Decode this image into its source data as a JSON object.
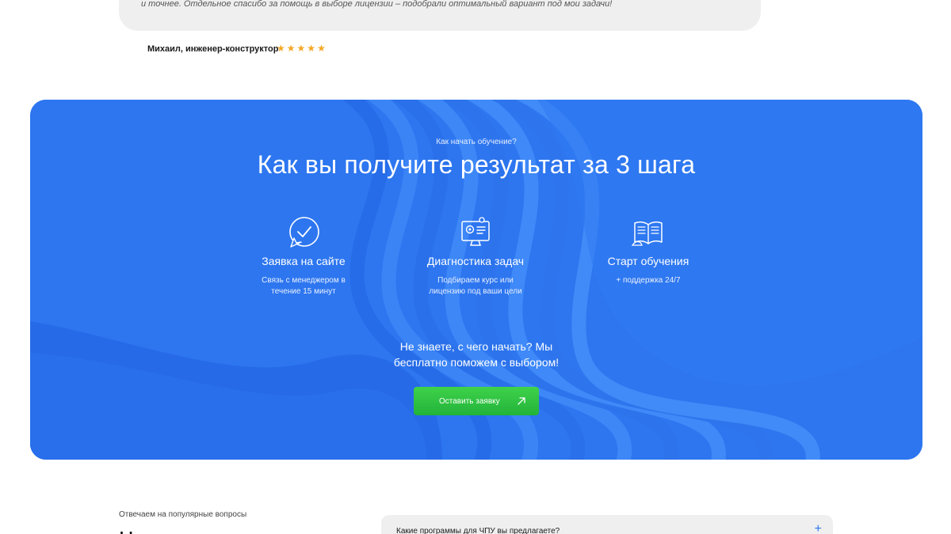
{
  "review": {
    "text": "и точнее. Отдельное спасибо за помощь в выборе лицензии – подобрали оптимальный вариант под мои задачи!",
    "author": "Михаил, инженер-конструктор",
    "rating": 5,
    "star_glyph": "★"
  },
  "steps_section": {
    "kicker": "Как начать обучение?",
    "title": "Как вы получите результат за 3 шага",
    "steps": [
      {
        "icon": "check-cursor-icon",
        "title": "Заявка на сайте",
        "desc_line1": "Связь с менеджером в",
        "desc_line2": "течение 15 минут"
      },
      {
        "icon": "monitor-gear-icon",
        "title": "Диагностика задач",
        "desc_line1": "Подбираем курс или",
        "desc_line2": "лицензию под ваши цели"
      },
      {
        "icon": "open-book-icon",
        "title": "Старт обучения",
        "desc_line1": "+ поддержка 24/7",
        "desc_line2": ""
      }
    ],
    "help_line1": "Не знаете, с чего начать? Мы",
    "help_line2": "бесплатно поможем с выбором!",
    "cta_label": "Оставить заявку",
    "colors": {
      "background": "#2d76f0",
      "cta": "#2ec041",
      "star": "#f5a623"
    }
  },
  "faq": {
    "kicker": "Отвечаем на популярные вопросы",
    "heading_partial": "Ч",
    "items": [
      {
        "question": "Какие программы для ЧПУ вы предлагаете?",
        "toggle": "+"
      }
    ]
  }
}
